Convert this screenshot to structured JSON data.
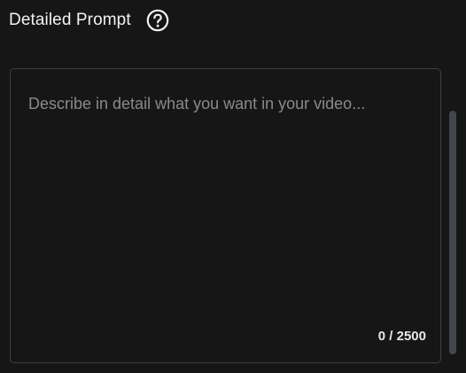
{
  "header": {
    "title": "Detailed Prompt",
    "help_icon": "question-circle-icon"
  },
  "prompt": {
    "value": "",
    "placeholder": "Describe in detail what you want in your video...",
    "counter": "0 / 2500"
  },
  "colors": {
    "background": "#161616",
    "border": "#3f3f3f",
    "placeholder": "#8a8a8a",
    "text": "#f2f2f2",
    "scrollbar": "#43474d"
  }
}
